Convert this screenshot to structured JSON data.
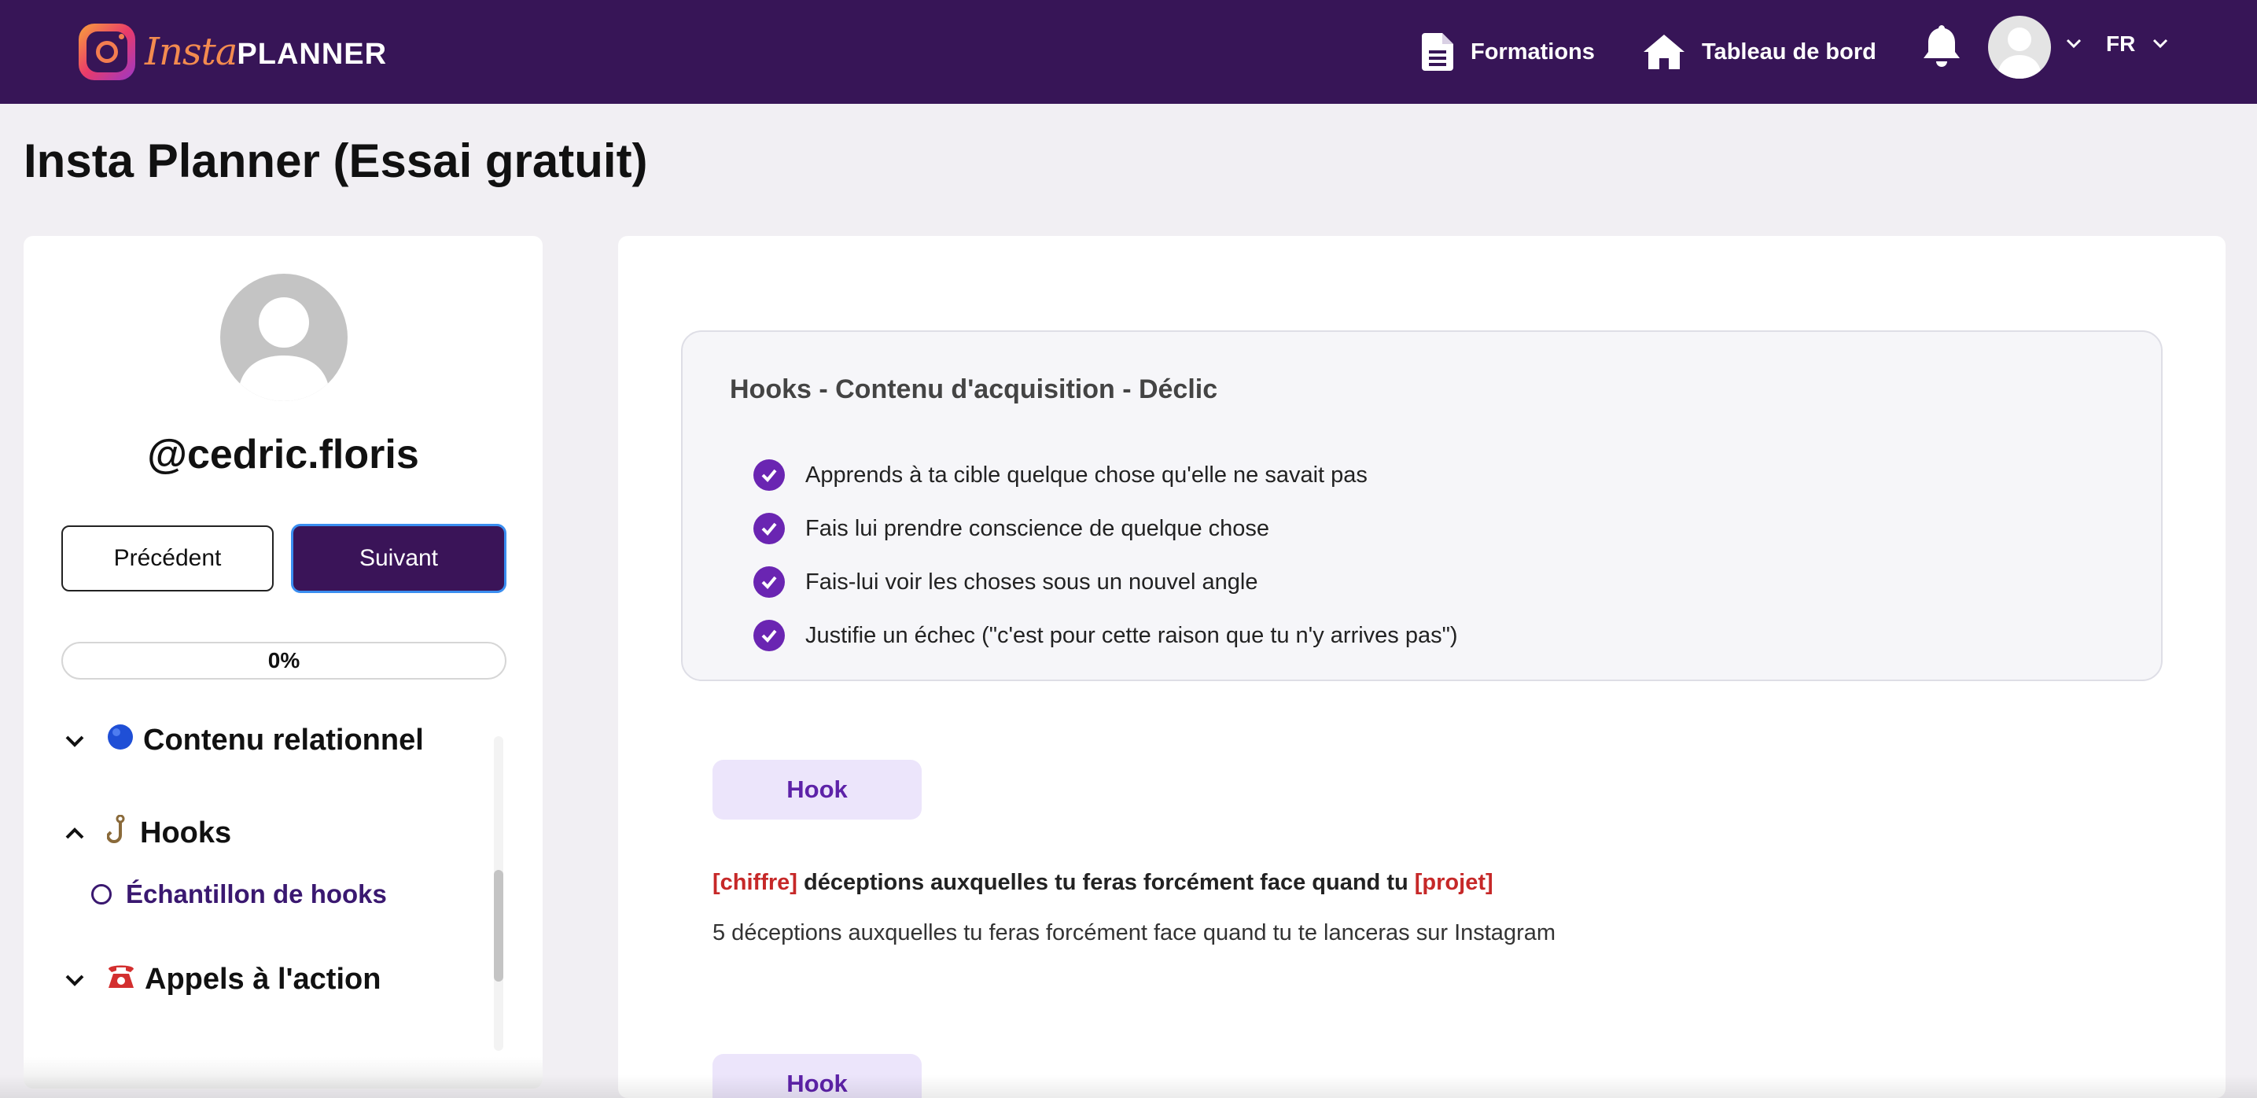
{
  "navbar": {
    "logo_insta": "Insta",
    "logo_planner": "PLANNER",
    "formations": "Formations",
    "tableau": "Tableau de bord",
    "language": "FR",
    "icons": [
      "document-icon",
      "home-icon",
      "bell-icon",
      "avatar",
      "chevron-down-icon"
    ]
  },
  "page": {
    "title": "Insta Planner (Essai gratuit)"
  },
  "sidebar": {
    "username": "@cedric.floris",
    "prev_label": "Précédent",
    "next_label": "Suivant",
    "progress_text": "0%",
    "progress_value": 0,
    "sections": [
      {
        "emoji": "🔵",
        "label": "Contenu relationnel",
        "expanded": false
      },
      {
        "emoji": "🪝",
        "label": "Hooks",
        "expanded": true,
        "items": [
          {
            "label": "Échantillon de hooks"
          }
        ]
      },
      {
        "emoji": "☎️",
        "label": "Appels à l'action",
        "expanded": false
      }
    ]
  },
  "main": {
    "card_title": "Hooks - Contenu d'acquisition - Déclic",
    "checklist": [
      "Apprends à ta cible quelque chose qu'elle ne savait pas",
      "Fais lui prendre conscience de quelque chose",
      "Fais-lui voir les choses sous un nouvel angle",
      "Justifie un échec (\"c'est pour cette raison que tu n'y arrives pas\")"
    ],
    "hooks": [
      {
        "badge": "Hook",
        "template_ph1": "[chiffre]",
        "template_mid": " déceptions auxquelles tu feras forcément face quand tu ",
        "template_ph2": "[projet]",
        "example": "5 déceptions auxquelles tu feras forcément face quand tu te lanceras sur Instagram"
      },
      {
        "badge": "Hook"
      }
    ]
  },
  "colors": {
    "navbar": "#371557",
    "accent": "#6a25b2",
    "placeholder_red": "#c62828",
    "badge_bg": "#ece5fb"
  }
}
